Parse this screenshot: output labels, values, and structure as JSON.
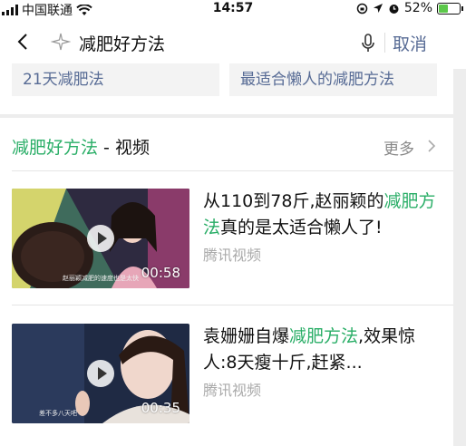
{
  "status": {
    "carrier": "中国联通",
    "time": "14:57",
    "battery": "52%",
    "battery_level": 0.52
  },
  "search": {
    "query": "减肥好方法",
    "cancel_label": "取消"
  },
  "previous_card": {
    "pills": [
      "21天减肥法",
      "最适合懒人的减肥方法"
    ]
  },
  "video_card": {
    "title_highlight": "减肥好方法",
    "title_rest": " - 视频",
    "more_label": "更多",
    "items": [
      {
        "title_pre": "从110到78斤,赵丽颖的",
        "title_hl": "减肥方法",
        "title_post": "真的是太适合懒人了!",
        "source": "腾讯视频",
        "duration": "00:58",
        "caption": "赵丽颖减肥的速度也是太快"
      },
      {
        "title_pre": "袁姗姗自爆",
        "title_hl": "减肥方法",
        "title_post": ",效果惊人:8天瘦十斤,赶紧...",
        "source": "腾讯视频",
        "duration": "00:35",
        "caption": "差不多八天吧"
      }
    ]
  },
  "colors": {
    "highlight": "#2aae67",
    "link": "#576b95"
  }
}
